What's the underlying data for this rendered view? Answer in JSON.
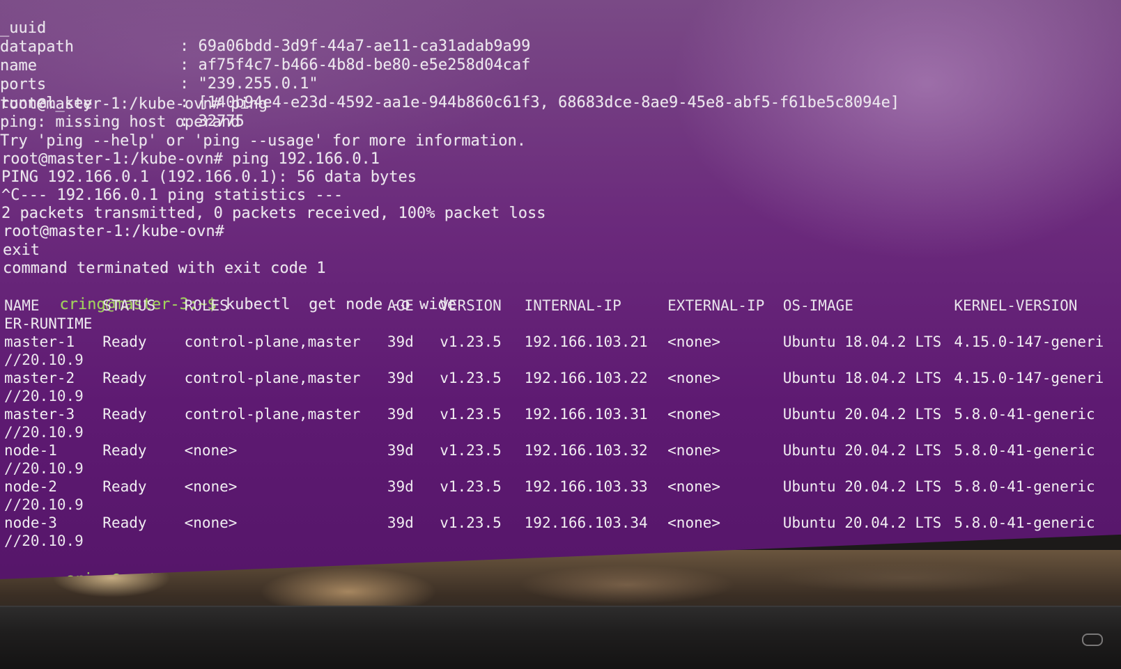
{
  "terminal": {
    "record_fields": [
      {
        "key": "_uuid",
        "value": ": 69a06bdd-3d9f-44a7-ae11-ca31adab9a99"
      },
      {
        "key": "datapath",
        "value": ": af75f4c7-b466-4b8d-be80-e5e258d04caf"
      },
      {
        "key": "name",
        "value": ": \"239.255.0.1\""
      },
      {
        "key": "ports",
        "value": ": [140b94e4-e23d-4592-aa1e-944b860c61f3, 68683dce-8ae9-45e8-abf5-f61be5c8094e]"
      },
      {
        "key": "tunnel_key",
        "value": ": 32775"
      }
    ],
    "lines": [
      "root@master-1:/kube-ovn# ping",
      "ping: missing host operand",
      "Try 'ping --help' or 'ping --usage' for more information.",
      "root@master-1:/kube-ovn# ping 192.166.0.1",
      "PING 192.166.0.1 (192.166.0.1): 56 data bytes",
      "^C--- 192.166.0.1 ping statistics ---",
      "2 packets transmitted, 0 packets received, 100% packet loss",
      "root@master-1:/kube-ovn#",
      "exit",
      "command terminated with exit code 1"
    ],
    "kubectl_prompt": "cring@master-3:~$",
    "kubectl_command": " kubectl  get node -o wide",
    "table": {
      "headers": [
        "NAME",
        "STATUS",
        "ROLES",
        "AGE",
        "VERSION",
        "INTERNAL-IP",
        "EXTERNAL-IP",
        "OS-IMAGE",
        "KERNEL-VERSION"
      ],
      "header_wrap": "ER-RUNTIME",
      "rows": [
        {
          "name": "master-1",
          "status": "Ready",
          "roles": "control-plane,master",
          "age": "39d",
          "version": "v1.23.5",
          "internal_ip": "192.166.103.21",
          "external_ip": "<none>",
          "os_image": "Ubuntu 18.04.2 LTS",
          "kernel": "4.15.0-147-generi",
          "wrap": "//20.10.9"
        },
        {
          "name": "master-2",
          "status": "Ready",
          "roles": "control-plane,master",
          "age": "39d",
          "version": "v1.23.5",
          "internal_ip": "192.166.103.22",
          "external_ip": "<none>",
          "os_image": "Ubuntu 18.04.2 LTS",
          "kernel": "4.15.0-147-generi",
          "wrap": "//20.10.9"
        },
        {
          "name": "master-3",
          "status": "Ready",
          "roles": "control-plane,master",
          "age": "39d",
          "version": "v1.23.5",
          "internal_ip": "192.166.103.31",
          "external_ip": "<none>",
          "os_image": "Ubuntu 20.04.2 LTS",
          "kernel": "5.8.0-41-generic",
          "wrap": "//20.10.9"
        },
        {
          "name": "node-1",
          "status": "Ready",
          "roles": "<none>",
          "age": "39d",
          "version": "v1.23.5",
          "internal_ip": "192.166.103.32",
          "external_ip": "<none>",
          "os_image": "Ubuntu 20.04.2 LTS",
          "kernel": "5.8.0-41-generic",
          "wrap": "//20.10.9"
        },
        {
          "name": "node-2",
          "status": "Ready",
          "roles": "<none>",
          "age": "39d",
          "version": "v1.23.5",
          "internal_ip": "192.166.103.33",
          "external_ip": "<none>",
          "os_image": "Ubuntu 20.04.2 LTS",
          "kernel": "5.8.0-41-generic",
          "wrap": "//20.10.9"
        },
        {
          "name": "node-3",
          "status": "Ready",
          "roles": "<none>",
          "age": "39d",
          "version": "v1.23.5",
          "internal_ip": "192.166.103.34",
          "external_ip": "<none>",
          "os_image": "Ubuntu 20.04.2 LTS",
          "kernel": "5.8.0-41-generic",
          "wrap": "//20.10.9"
        }
      ]
    },
    "final_prompt": "cring@master-3:~$"
  },
  "colors": {
    "background": "#6b2a7c",
    "text": "#ece6ee",
    "prompt": "#9fd356"
  }
}
